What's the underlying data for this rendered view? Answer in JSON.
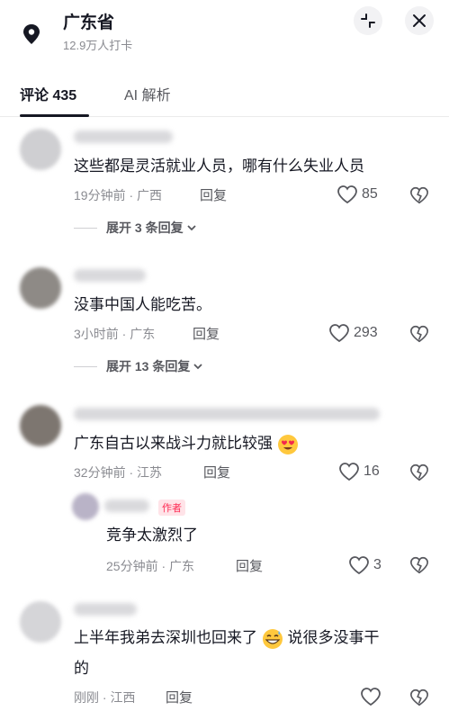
{
  "header": {
    "location_title": "广东省",
    "location_subtitle": "12.9万人打卡"
  },
  "tabs": [
    {
      "label": "评论 435"
    },
    {
      "label": "AI 解析"
    }
  ],
  "comments": [
    {
      "text": "这些都是灵活就业人员，哪有什么失业人员",
      "time_location": "19分钟前 · 广西",
      "reply_label": "回复",
      "likes": "85",
      "expand_label": "展开 3 条回复"
    },
    {
      "text": "没事中国人能吃苦。",
      "time_location": "3小时前 · 广东",
      "reply_label": "回复",
      "likes": "293",
      "expand_label": "展开 13 条回复"
    },
    {
      "text": "广东自古以来战斗力就比较强",
      "time_location": "32分钟前 · 江苏",
      "reply_label": "回复",
      "likes": "16"
    },
    {
      "text_line1": "上半年我弟去深圳也回来了",
      "text_line1_after": "说很多没事干",
      "text_line2": "的",
      "time_location": "刚刚 · 江西",
      "reply_label": "回复"
    }
  ],
  "reply": {
    "badge": "作者",
    "text": "竞争太激烈了",
    "time_location": "25分钟前 · 广东",
    "reply_label": "回复",
    "likes": "3"
  },
  "icons": {
    "location": "map-pin-icon",
    "collapse": "collapse-icon",
    "close": "close-icon",
    "like": "heart-outline-icon",
    "dislike": "broken-heart-icon",
    "expand": "chevron-down-icon",
    "emoji_love": "heart-eyes-emoji",
    "emoji_sweat": "grinning-sweat-emoji"
  },
  "colors": {
    "text": "#161823",
    "secondary": "#8a8b91",
    "author_badge": "#fe2c55"
  }
}
